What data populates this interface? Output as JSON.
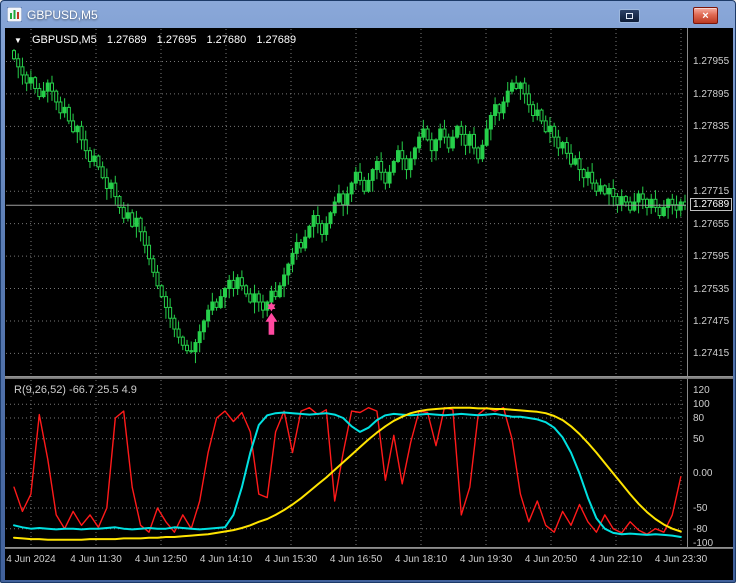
{
  "window": {
    "title": "GBPUSD,M5"
  },
  "icons": {
    "close": "×",
    "dropdown": "▼"
  },
  "colors": {
    "grid": "#777777",
    "candle": "#26cf4a",
    "candle_up_fill": "#26cf4a",
    "candle_down_fill": "#000000",
    "bid_line": "#9e9e9e",
    "red_line": "#ff1a1a",
    "cyan_line": "#00e1e1",
    "yellow_line": "#ffe400",
    "arrow": "#ff49a0",
    "axis_text": "#cfcfcf"
  },
  "main_chart": {
    "info": {
      "symbol": "GBPUSD,M5",
      "open": "1.27689",
      "high": "1.27695",
      "low": "1.27680",
      "close": "1.27689"
    },
    "bid": "1.27689",
    "price_labels": [
      "1.27955",
      "1.27895",
      "1.27835",
      "1.27775",
      "1.27715",
      "1.27655",
      "1.27595",
      "1.27535",
      "1.27475",
      "1.27415"
    ],
    "signal_arrow": {
      "bar_index": 61,
      "price": 1.27505,
      "color": "#ff49a0"
    }
  },
  "indicator": {
    "label": "R(9,26,52) -66.7 25.5 4.9",
    "axis_labels": [
      "120",
      "100",
      "80",
      "50",
      "0.00",
      "-50",
      "-80",
      "-100"
    ],
    "axis_values": [
      120,
      100,
      80,
      50,
      0,
      -50,
      -80,
      -100
    ]
  },
  "time_axis": {
    "labels": [
      "4 Jun 2024",
      "4 Jun 11:30",
      "4 Jun 12:50",
      "4 Jun 14:10",
      "4 Jun 15:30",
      "4 Jun 16:50",
      "4 Jun 18:10",
      "4 Jun 19:30",
      "4 Jun 20:50",
      "4 Jun 22:10",
      "4 Jun 23:30"
    ]
  },
  "chart_data": [
    {
      "type": "candlestick",
      "title": "GBPUSD M5",
      "price_base": 1.27,
      "y_axis": {
        "range": [
          1.27375,
          1.28015
        ],
        "labels": [
          "1.27955",
          "1.27895",
          "1.27835",
          "1.27775",
          "1.27715",
          "1.27655",
          "1.27595",
          "1.27535",
          "1.27475",
          "1.27415"
        ]
      },
      "current_bid": 1.27689,
      "closes_pips": [
        96.0,
        94.5,
        93.0,
        91.5,
        92.5,
        90.5,
        89.0,
        90.0,
        91.5,
        90.0,
        88.0,
        86.0,
        87.0,
        84.5,
        82.5,
        83.5,
        81.0,
        79.0,
        77.0,
        78.0,
        76.0,
        74.0,
        72.0,
        73.0,
        70.5,
        68.5,
        66.5,
        67.5,
        65.0,
        66.5,
        64.0,
        61.5,
        59.0,
        56.5,
        54.0,
        52.0,
        50.0,
        48.0,
        46.0,
        44.5,
        43.0,
        42.0,
        41.8,
        43.5,
        45.5,
        47.5,
        49.5,
        51.0,
        50.0,
        52.0,
        53.5,
        55.0,
        53.5,
        55.5,
        54.0,
        52.5,
        51.0,
        52.5,
        51.0,
        49.5,
        51.0,
        53.0,
        52.0,
        54.0,
        56.0,
        58.0,
        60.0,
        62.0,
        61.0,
        63.0,
        65.0,
        67.0,
        65.5,
        63.5,
        65.5,
        67.5,
        69.5,
        71.0,
        69.0,
        71.0,
        73.0,
        75.0,
        73.5,
        71.5,
        73.5,
        75.5,
        77.0,
        75.0,
        73.0,
        75.0,
        77.0,
        79.0,
        77.5,
        75.5,
        77.5,
        79.5,
        81.5,
        83.0,
        81.0,
        79.0,
        81.0,
        83.0,
        81.5,
        79.5,
        81.5,
        83.5,
        82.0,
        80.0,
        82.0,
        79.5,
        77.5,
        80.0,
        83.0,
        85.5,
        87.5,
        86.0,
        88.0,
        90.0,
        91.5,
        90.5,
        91.5,
        89.5,
        87.5,
        85.5,
        86.5,
        84.5,
        82.5,
        83.5,
        81.5,
        79.5,
        80.5,
        78.5,
        76.5,
        77.5,
        75.5,
        74.0,
        75.0,
        73.0,
        71.5,
        72.5,
        71.0,
        72.0,
        70.5,
        69.0,
        70.5,
        69.5,
        68.0,
        69.5,
        71.0,
        70.0,
        68.5,
        70.0,
        68.5,
        67.0,
        68.5,
        70.0,
        69.0,
        68.0,
        69.5,
        68.9
      ]
    },
    {
      "type": "line",
      "title": "R(9,26,52)",
      "values_label": "-66.7 25.5 4.9",
      "y_axis": {
        "range": [
          -105,
          135
        ],
        "labels": [
          "120",
          "100",
          "80",
          "50",
          "0.00",
          "-50",
          "-80",
          "-100"
        ]
      },
      "levels": [
        100,
        80,
        50,
        0,
        -50,
        -80
      ],
      "x_step_bars": 2,
      "series": [
        {
          "name": "red",
          "color": "#ff1a1a",
          "values": [
            -20,
            -55,
            -30,
            85,
            20,
            -60,
            -80,
            -55,
            -75,
            -60,
            -78,
            -50,
            80,
            90,
            -20,
            -75,
            -85,
            -50,
            -70,
            -85,
            -60,
            -80,
            -40,
            30,
            80,
            90,
            75,
            88,
            60,
            -30,
            -35,
            60,
            90,
            30,
            90,
            95,
            85,
            92,
            -40,
            30,
            90,
            88,
            95,
            90,
            -10,
            55,
            -15,
            45,
            90,
            88,
            40,
            95,
            92,
            -60,
            -20,
            85,
            95,
            90,
            95,
            50,
            -30,
            -70,
            -40,
            -75,
            -85,
            -55,
            -75,
            -45,
            -70,
            -85,
            -60,
            -80,
            -86,
            -70,
            -82,
            -88,
            -80,
            -85,
            -60,
            -5
          ]
        },
        {
          "name": "cyan",
          "color": "#00e1e1",
          "values": [
            -75,
            -78,
            -80,
            -79,
            -80,
            -81,
            -80,
            -80,
            -81,
            -80,
            -80,
            -79,
            -78,
            -80,
            -81,
            -80,
            -79,
            -80,
            -80,
            -78,
            -79,
            -80,
            -81,
            -80,
            -79,
            -78,
            -60,
            -20,
            30,
            70,
            84,
            87,
            88,
            87,
            86,
            85,
            86,
            87,
            85,
            80,
            68,
            60,
            66,
            77,
            84,
            86,
            85,
            84,
            85,
            86,
            85,
            84,
            85,
            86,
            85,
            84,
            85,
            86,
            84,
            82,
            82,
            80,
            78,
            74,
            66,
            52,
            30,
            0,
            -35,
            -65,
            -80,
            -86,
            -88,
            -87,
            -88,
            -89,
            -88,
            -89,
            -90,
            -92
          ]
        },
        {
          "name": "yellow",
          "color": "#ffe400",
          "values": [
            -93,
            -94,
            -95,
            -95,
            -96,
            -96,
            -96,
            -96,
            -96,
            -95,
            -95,
            -95,
            -95,
            -94,
            -94,
            -94,
            -93,
            -93,
            -92,
            -92,
            -91,
            -90,
            -89,
            -88,
            -86,
            -84,
            -82,
            -79,
            -75,
            -70,
            -66,
            -60,
            -53,
            -45,
            -36,
            -26,
            -16,
            -6,
            5,
            16,
            27,
            38,
            49,
            59,
            68,
            76,
            82,
            87,
            90,
            92,
            93,
            94,
            95,
            95,
            95,
            94,
            94,
            93,
            93,
            92,
            91,
            90,
            89,
            87,
            83,
            77,
            68,
            57,
            44,
            30,
            15,
            0,
            -15,
            -30,
            -44,
            -56,
            -66,
            -74,
            -80,
            -84
          ]
        }
      ]
    }
  ]
}
